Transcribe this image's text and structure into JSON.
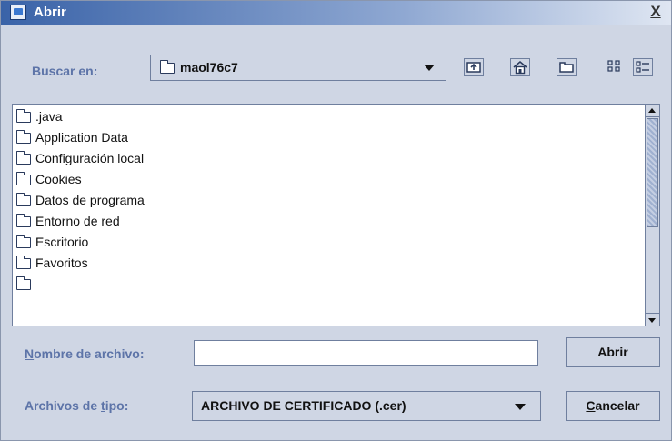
{
  "window": {
    "title": "Abrir",
    "close_glyph": "X"
  },
  "lookin": {
    "label_prefix": "",
    "label_mnemonic": "",
    "label": "Buscar en:",
    "current_folder": "maol76c7"
  },
  "toolbar": {
    "buttons": [
      "up-folder",
      "home",
      "new-folder",
      "list-view",
      "details-view"
    ]
  },
  "files": [
    ".java",
    "Application Data",
    "Configuración local",
    "Cookies",
    "Datos de programa",
    "Entorno de red",
    "Escritorio",
    "Favoritos"
  ],
  "filename": {
    "label_mnemonic": "N",
    "label_rest": "ombre de archivo:",
    "value": ""
  },
  "filetype": {
    "label_prefix": "Archivos de ",
    "label_mnemonic": "t",
    "label_rest": "ipo:",
    "selected": "ARCHIVO DE CERTIFICADO (.cer)"
  },
  "buttons": {
    "open": "Abrir",
    "cancel_mnemonic": "C",
    "cancel_rest": "ancelar"
  },
  "colors": {
    "accent_label": "#5d74a8",
    "window_bg": "#cfd6e4"
  }
}
